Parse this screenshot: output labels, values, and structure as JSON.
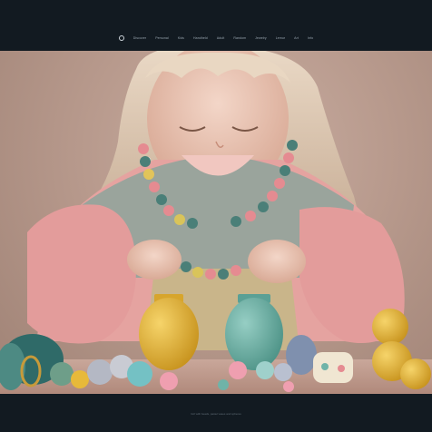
{
  "nav": {
    "logo_icon": "circle-logo-icon",
    "items": [
      {
        "label": "Discover"
      },
      {
        "label": "Personal"
      },
      {
        "label": "Kids"
      },
      {
        "label": "Handheld"
      },
      {
        "label": "Adult"
      },
      {
        "label": "Random"
      },
      {
        "label": "Jewelry"
      },
      {
        "label": "Lemur"
      },
      {
        "label": "Art"
      },
      {
        "label": "Info"
      }
    ]
  },
  "hero": {
    "image": "girl-stringing-beads-photo",
    "colors": {
      "background": "#b89a8d",
      "sweater": "#e39c9b",
      "vase_yellow": "#e7b93a",
      "vase_teal": "#6fb3a8"
    }
  },
  "footer": {
    "caption": "Girl with beads, pastel vases and spheres"
  }
}
